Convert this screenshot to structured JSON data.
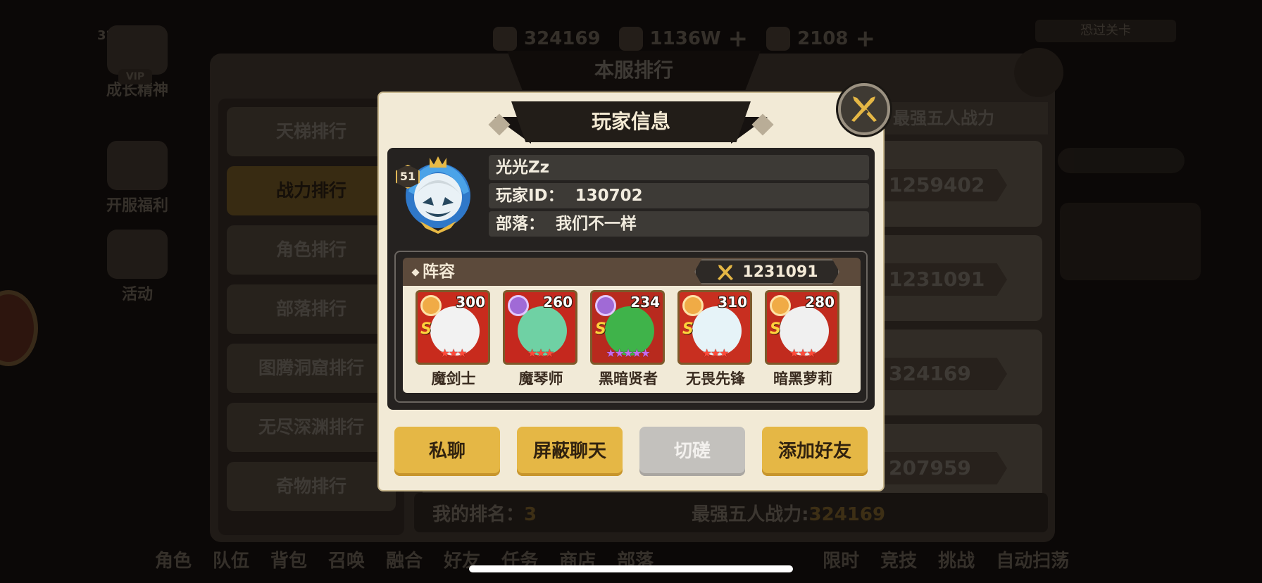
{
  "background": {
    "resources": [
      {
        "icon": "cloth-icon",
        "value": "324169"
      },
      {
        "icon": "coin-icon",
        "value": "1136W"
      },
      {
        "icon": "stone-icon",
        "value": "2108"
      }
    ],
    "top_right_button": "恐过关卡"
  },
  "modal": {
    "title": "玩家信息",
    "player": {
      "level": "51",
      "name": "光光Zz",
      "id_label": "玩家ID：",
      "id_value": "130702",
      "tribe_label": "部落：",
      "tribe_value": "我们不一样"
    },
    "lineup": {
      "title": "阵容",
      "power": "1231091",
      "heroes": [
        {
          "name": "魔剑士",
          "level": "300",
          "grade": "S",
          "stars": "★★★",
          "element": "sun",
          "color": "#c82b1d"
        },
        {
          "name": "魔琴师",
          "level": "260",
          "grade": "",
          "stars": "★★★",
          "element": "moon",
          "color": "#c5281e"
        },
        {
          "name": "黑暗贤者",
          "level": "234",
          "grade": "S",
          "stars": "★★★★★",
          "element": "moon",
          "color": "#b82a1e"
        },
        {
          "name": "无畏先锋",
          "level": "310",
          "grade": "S",
          "stars": "★★★",
          "element": "sun",
          "color": "#c82f20"
        },
        {
          "name": "暗黑萝莉",
          "level": "280",
          "grade": "S",
          "stars": "★★★",
          "element": "sun",
          "color": "#c12b1e"
        }
      ]
    },
    "buttons": {
      "private_chat": "私聊",
      "block_chat": "屏蔽聊天",
      "spar": "切磋",
      "add_friend": "添加好友"
    }
  },
  "bg_ranking": {
    "title": "本服排行",
    "tabs": [
      "天梯排行",
      "战力排行",
      "角色排行",
      "部落排行",
      "图腾洞窟排行",
      "无尽深渊排行",
      "奇物排行"
    ],
    "active_tab": "战力排行",
    "header": "最强五人战力",
    "values": [
      "1259402",
      "1231091",
      "324169",
      "207959"
    ],
    "my_rank_label": "我的排名：",
    "my_rank_value": "3",
    "my_power_label": "最强五人战力:",
    "my_power_value": "324169"
  },
  "bg_left_icons": [
    {
      "label": "成长精神"
    },
    {
      "label": "开服福利"
    },
    {
      "label": "活动"
    }
  ],
  "bg_bottom_nav": [
    "角色",
    "队伍",
    "背包",
    "召唤",
    "融合",
    "好友",
    "任务",
    "商店",
    "部落",
    "",
    "限时",
    "竞技",
    "挑战",
    "自动扫荡"
  ]
}
